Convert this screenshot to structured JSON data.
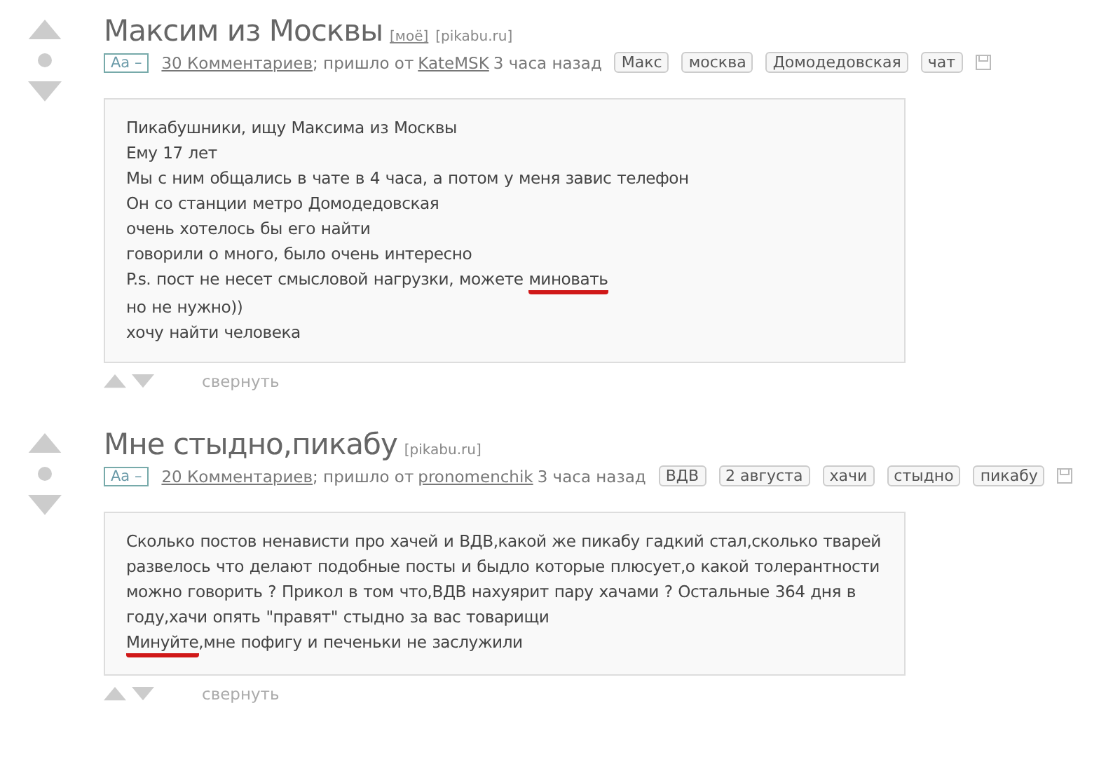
{
  "posts": [
    {
      "title": "Максим из Москвы",
      "source_links": [
        "[моё]"
      ],
      "source": "[pikabu.ru]",
      "font_toggle": "Аа –",
      "comments": "30 Комментариев",
      "from_text": "; пришло от",
      "author": "KateMSK",
      "time": "3 часа назад",
      "tags": [
        "Макс",
        "москва",
        "Домодедовская",
        "чат"
      ],
      "paragraphs": [
        [
          {
            "text": "Пикабушники, ищу Максима из Москвы",
            "marked": false
          }
        ],
        [
          {
            "text": "Ему 17 лет",
            "marked": false
          }
        ],
        [
          {
            "text": "Мы с ним общались в чате в 4 часа, а потом у меня завис телефон",
            "marked": false
          }
        ],
        [
          {
            "text": "Он со станции метро Домодедовская",
            "marked": false
          }
        ],
        [
          {
            "text": "очень хотелось бы его найти",
            "marked": false
          }
        ],
        [
          {
            "text": "говорили о много, было очень интересно",
            "marked": false
          }
        ],
        [
          {
            "text": "P.s. пост не несет смысловой нагрузки, можете ",
            "marked": false
          },
          {
            "text": "миновать",
            "marked": true
          }
        ],
        [
          {
            "text": "но не нужно))",
            "marked": false
          }
        ],
        [
          {
            "text": "хочу найти человека",
            "marked": false
          }
        ]
      ],
      "collapse": "свернуть"
    },
    {
      "title": "Мне стыдно,пикабу",
      "source": "[pikabu.ru]",
      "font_toggle": "Аа –",
      "comments": "20 Комментариев",
      "from_text": "; пришло от",
      "author": "pronomenchik",
      "time": "3 часа назад",
      "tags": [
        "ВДВ",
        "2 августа",
        "хачи",
        "стыдно",
        "пикабу"
      ],
      "paragraphs": [
        [
          {
            "text": "Сколько постов ненависти про хачей и ВДВ,какой же пикабу гадкий стал,сколько тварей развелось что делают подобные посты и быдло которые плюсует,о какой толерантности можно говорить ? Прикол в том что,ВДВ нахуярит пару хачами ? Остальные 364 дня в году,хачи опять \"правят\" стыдно за вас товарищи",
            "marked": false
          }
        ],
        [
          {
            "text": "Минуйте",
            "marked": true
          },
          {
            "text": ",мне пофигу и печеньки не заслужили",
            "marked": false
          }
        ]
      ],
      "collapse": "свернуть"
    }
  ]
}
